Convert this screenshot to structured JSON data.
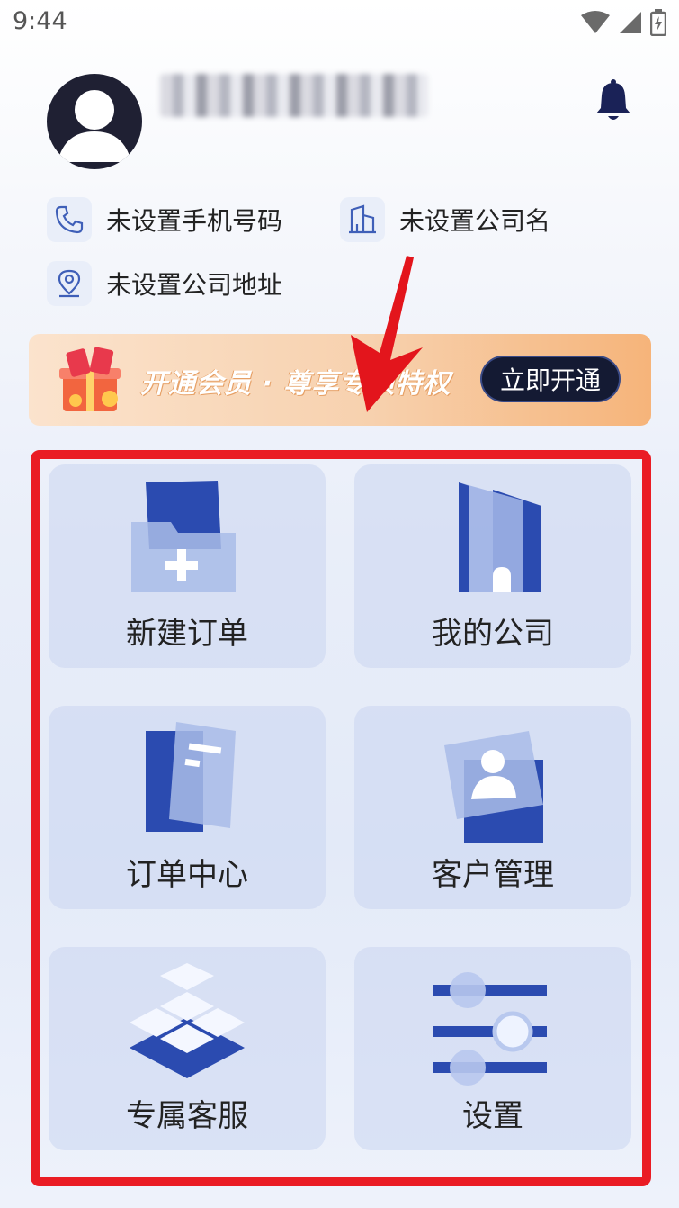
{
  "status_bar": {
    "time": "9:44"
  },
  "profile": {
    "avatar_icon": "user-avatar-icon",
    "bell_icon": "bell-icon"
  },
  "info": {
    "phone": "未设置手机号码",
    "company_name": "未设置公司名",
    "company_address": "未设置公司地址"
  },
  "banner": {
    "text": "开通会员 · 尊享专项特权",
    "button_label": "立即开通"
  },
  "menu": {
    "items": [
      {
        "label": "新建订单",
        "icon": "folder-add-icon"
      },
      {
        "label": "我的公司",
        "icon": "building-icon"
      },
      {
        "label": "订单中心",
        "icon": "document-icon"
      },
      {
        "label": "客户管理",
        "icon": "contact-card-icon"
      },
      {
        "label": "专属客服",
        "icon": "layers-icon"
      },
      {
        "label": "设置",
        "icon": "sliders-icon"
      }
    ]
  },
  "colors": {
    "accent": "#3050b8",
    "frame": "#ea1c24",
    "banner_button": "#141a33"
  }
}
